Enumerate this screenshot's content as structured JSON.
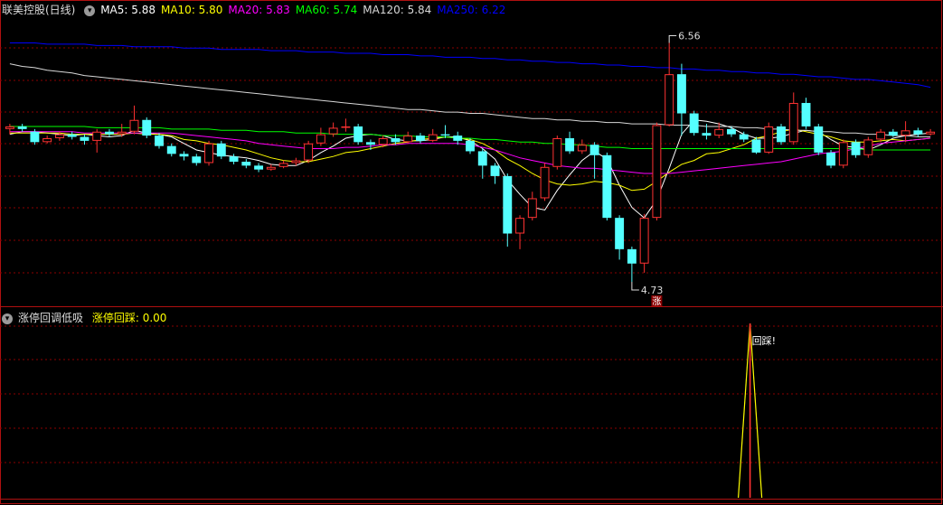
{
  "header": {
    "stock_name": "联美控股(日线)",
    "ma": [
      {
        "label": "MA5: 5.88",
        "color": "#ffffff"
      },
      {
        "label": "MA10: 5.80",
        "color": "#ffff00"
      },
      {
        "label": "MA20: 5.83",
        "color": "#ff00ff"
      },
      {
        "label": "MA60: 5.74",
        "color": "#00ff00"
      },
      {
        "label": "MA120: 5.84",
        "color": "#d8d8d8"
      },
      {
        "label": "MA250: 6.22",
        "color": "#0000ff"
      }
    ]
  },
  "indicator": {
    "name": "涨停回调低吸",
    "value_label": "涨停回踩: 0.00",
    "value_color": "#ffff00",
    "signal_label": "回踩!"
  },
  "colors": {
    "up": "#ff3232",
    "down": "#54ffff",
    "grid": "#8b0000",
    "border": "#b01010"
  },
  "chart_data": [
    {
      "type": "candlestick",
      "y_range": [
        4.55,
        6.75
      ],
      "high_annotation": "6.56",
      "low_annotation": "4.73",
      "limit_up_marker": "涨",
      "candles": [
        [
          5.9,
          5.92,
          5.94,
          5.86
        ],
        [
          5.92,
          5.9,
          5.94,
          5.88
        ],
        [
          5.88,
          5.8,
          5.9,
          5.78
        ],
        [
          5.8,
          5.83,
          5.85,
          5.79
        ],
        [
          5.83,
          5.86,
          5.88,
          5.81
        ],
        [
          5.86,
          5.84,
          5.88,
          5.82
        ],
        [
          5.84,
          5.81,
          5.86,
          5.78
        ],
        [
          5.81,
          5.88,
          5.9,
          5.72
        ],
        [
          5.88,
          5.86,
          5.9,
          5.84
        ],
        [
          5.86,
          5.88,
          5.94,
          5.84
        ],
        [
          5.88,
          5.97,
          6.08,
          5.86
        ],
        [
          5.97,
          5.85,
          5.99,
          5.83
        ],
        [
          5.85,
          5.77,
          5.87,
          5.75
        ],
        [
          5.77,
          5.71,
          5.79,
          5.69
        ],
        [
          5.71,
          5.69,
          5.73,
          5.66
        ],
        [
          5.69,
          5.64,
          5.71,
          5.62
        ],
        [
          5.64,
          5.79,
          5.81,
          5.62
        ],
        [
          5.79,
          5.69,
          5.81,
          5.67
        ],
        [
          5.69,
          5.65,
          5.71,
          5.63
        ],
        [
          5.65,
          5.62,
          5.67,
          5.6
        ],
        [
          5.62,
          5.59,
          5.64,
          5.57
        ],
        [
          5.59,
          5.61,
          5.63,
          5.58
        ],
        [
          5.61,
          5.64,
          5.66,
          5.6
        ],
        [
          5.64,
          5.66,
          5.68,
          5.62
        ],
        [
          5.66,
          5.79,
          5.81,
          5.64
        ],
        [
          5.79,
          5.86,
          5.91,
          5.77
        ],
        [
          5.86,
          5.91,
          5.95,
          5.84
        ],
        [
          5.91,
          5.92,
          5.98,
          5.88
        ],
        [
          5.92,
          5.8,
          5.94,
          5.78
        ],
        [
          5.8,
          5.78,
          5.82,
          5.74
        ],
        [
          5.78,
          5.83,
          5.85,
          5.76
        ],
        [
          5.83,
          5.8,
          5.86,
          5.78
        ],
        [
          5.8,
          5.85,
          5.88,
          5.79
        ],
        [
          5.85,
          5.81,
          5.87,
          5.79
        ],
        [
          5.81,
          5.86,
          5.9,
          5.8
        ],
        [
          5.86,
          5.85,
          5.93,
          5.83
        ],
        [
          5.85,
          5.81,
          5.88,
          5.78
        ],
        [
          5.81,
          5.73,
          5.83,
          5.71
        ],
        [
          5.73,
          5.62,
          5.75,
          5.52
        ],
        [
          5.62,
          5.54,
          5.64,
          5.48
        ],
        [
          5.54,
          5.1,
          5.56,
          5.0
        ],
        [
          5.1,
          5.22,
          5.24,
          4.98
        ],
        [
          5.22,
          5.37,
          5.42,
          5.2
        ],
        [
          5.37,
          5.61,
          5.64,
          5.35
        ],
        [
          5.61,
          5.83,
          5.85,
          5.59
        ],
        [
          5.83,
          5.73,
          5.88,
          5.71
        ],
        [
          5.73,
          5.78,
          5.82,
          5.71
        ],
        [
          5.78,
          5.7,
          5.8,
          5.52
        ],
        [
          5.7,
          5.22,
          5.72,
          5.2
        ],
        [
          5.22,
          4.98,
          5.24,
          4.9
        ],
        [
          4.98,
          4.87,
          5.0,
          4.73
        ],
        [
          4.87,
          5.22,
          5.25,
          4.8
        ],
        [
          5.22,
          5.93,
          5.95,
          5.2
        ],
        [
          5.93,
          6.32,
          6.56,
          5.92
        ],
        [
          6.32,
          6.02,
          6.4,
          5.85
        ],
        [
          6.02,
          5.87,
          6.04,
          5.85
        ],
        [
          5.87,
          5.85,
          5.94,
          5.82
        ],
        [
          5.85,
          5.9,
          5.95,
          5.83
        ],
        [
          5.9,
          5.86,
          5.92,
          5.84
        ],
        [
          5.86,
          5.82,
          5.88,
          5.8
        ],
        [
          5.82,
          5.72,
          5.84,
          5.71
        ],
        [
          5.72,
          5.92,
          5.95,
          5.71
        ],
        [
          5.92,
          5.8,
          5.94,
          5.78
        ],
        [
          5.8,
          6.1,
          6.18,
          5.78
        ],
        [
          6.1,
          5.92,
          6.14,
          5.9
        ],
        [
          5.92,
          5.72,
          5.94,
          5.7
        ],
        [
          5.72,
          5.62,
          5.74,
          5.6
        ],
        [
          5.62,
          5.8,
          5.82,
          5.6
        ],
        [
          5.8,
          5.7,
          5.82,
          5.68
        ],
        [
          5.7,
          5.82,
          5.84,
          5.68
        ],
        [
          5.82,
          5.88,
          5.9,
          5.8
        ],
        [
          5.88,
          5.85,
          5.9,
          5.84
        ],
        [
          5.85,
          5.89,
          5.96,
          5.8
        ],
        [
          5.89,
          5.86,
          5.91,
          5.84
        ],
        [
          5.86,
          5.88,
          5.9,
          5.85
        ]
      ],
      "series": [
        {
          "name": "MA5",
          "color": "#ffffff",
          "values": [
            5.86,
            5.88,
            5.88,
            5.87,
            5.86,
            5.85,
            5.86,
            5.85,
            5.84,
            5.85,
            5.89,
            5.87,
            5.86,
            5.84,
            5.79,
            5.74,
            5.72,
            5.7,
            5.69,
            5.68,
            5.66,
            5.63,
            5.62,
            5.62,
            5.66,
            5.72,
            5.77,
            5.83,
            5.85,
            5.86,
            5.85,
            5.82,
            5.81,
            5.81,
            5.82,
            5.84,
            5.84,
            5.81,
            5.75,
            5.67,
            5.51,
            5.4,
            5.3,
            5.28,
            5.43,
            5.55,
            5.66,
            5.73,
            5.67,
            5.47,
            5.3,
            5.22,
            5.36,
            5.6,
            5.86,
            5.97,
            5.96,
            5.94,
            5.91,
            5.86,
            5.83,
            5.83,
            5.84,
            5.87,
            5.89,
            5.88,
            5.82,
            5.77,
            5.76,
            5.74,
            5.78,
            5.83,
            5.85,
            5.86,
            5.87
          ]
        },
        {
          "name": "MA10",
          "color": "#ffff00",
          "values": [
            5.87,
            5.87,
            5.87,
            5.87,
            5.87,
            5.86,
            5.86,
            5.86,
            5.86,
            5.86,
            5.87,
            5.86,
            5.86,
            5.85,
            5.82,
            5.81,
            5.79,
            5.78,
            5.76,
            5.74,
            5.71,
            5.68,
            5.66,
            5.65,
            5.65,
            5.67,
            5.69,
            5.72,
            5.73,
            5.75,
            5.77,
            5.79,
            5.8,
            5.82,
            5.83,
            5.84,
            5.83,
            5.82,
            5.79,
            5.74,
            5.67,
            5.62,
            5.56,
            5.51,
            5.48,
            5.47,
            5.48,
            5.5,
            5.49,
            5.47,
            5.43,
            5.44,
            5.5,
            5.57,
            5.63,
            5.66,
            5.71,
            5.72,
            5.75,
            5.78,
            5.83,
            5.85,
            5.88,
            5.9,
            5.88,
            5.86,
            5.84,
            5.81,
            5.8,
            5.8,
            5.81,
            5.82,
            5.81,
            5.82,
            5.83
          ]
        },
        {
          "name": "MA20",
          "color": "#ff00ff",
          "values": [
            5.88,
            5.88,
            5.88,
            5.88,
            5.88,
            5.88,
            5.87,
            5.87,
            5.87,
            5.87,
            5.87,
            5.87,
            5.87,
            5.87,
            5.86,
            5.85,
            5.84,
            5.83,
            5.82,
            5.81,
            5.79,
            5.78,
            5.77,
            5.76,
            5.75,
            5.75,
            5.75,
            5.76,
            5.76,
            5.77,
            5.78,
            5.78,
            5.79,
            5.79,
            5.79,
            5.79,
            5.79,
            5.78,
            5.76,
            5.74,
            5.71,
            5.68,
            5.66,
            5.64,
            5.62,
            5.61,
            5.6,
            5.6,
            5.59,
            5.58,
            5.57,
            5.56,
            5.56,
            5.56,
            5.57,
            5.58,
            5.59,
            5.6,
            5.61,
            5.62,
            5.63,
            5.64,
            5.65,
            5.67,
            5.69,
            5.71,
            5.72,
            5.73,
            5.75,
            5.77,
            5.79,
            5.8,
            5.81,
            5.82,
            5.83
          ]
        },
        {
          "name": "MA60",
          "color": "#00ff00",
          "values": [
            5.92,
            5.92,
            5.92,
            5.92,
            5.92,
            5.92,
            5.92,
            5.91,
            5.91,
            5.91,
            5.91,
            5.91,
            5.91,
            5.9,
            5.9,
            5.9,
            5.9,
            5.89,
            5.89,
            5.89,
            5.88,
            5.88,
            5.88,
            5.87,
            5.87,
            5.87,
            5.86,
            5.86,
            5.86,
            5.86,
            5.85,
            5.85,
            5.85,
            5.84,
            5.84,
            5.84,
            5.83,
            5.83,
            5.82,
            5.82,
            5.81,
            5.8,
            5.8,
            5.79,
            5.79,
            5.78,
            5.78,
            5.77,
            5.76,
            5.76,
            5.75,
            5.75,
            5.75,
            5.75,
            5.75,
            5.75,
            5.75,
            5.75,
            5.75,
            5.75,
            5.75,
            5.75,
            5.75,
            5.75,
            5.75,
            5.75,
            5.75,
            5.75,
            5.75,
            5.74,
            5.74,
            5.74,
            5.74,
            5.74,
            5.74
          ]
        },
        {
          "name": "MA120",
          "color": "#d8d8d8",
          "values": [
            6.4,
            6.38,
            6.37,
            6.35,
            6.34,
            6.33,
            6.31,
            6.3,
            6.29,
            6.28,
            6.27,
            6.26,
            6.25,
            6.24,
            6.23,
            6.22,
            6.21,
            6.2,
            6.19,
            6.18,
            6.17,
            6.16,
            6.15,
            6.14,
            6.13,
            6.12,
            6.11,
            6.1,
            6.09,
            6.08,
            6.07,
            6.06,
            6.05,
            6.05,
            6.04,
            6.03,
            6.03,
            6.02,
            6.02,
            6.01,
            6.0,
            5.99,
            5.98,
            5.98,
            5.97,
            5.97,
            5.96,
            5.96,
            5.95,
            5.95,
            5.94,
            5.94,
            5.94,
            5.93,
            5.93,
            5.93,
            5.92,
            5.92,
            5.92,
            5.91,
            5.91,
            5.9,
            5.9,
            5.89,
            5.89,
            5.88,
            5.88,
            5.87,
            5.87,
            5.86,
            5.86,
            5.85,
            5.85,
            5.84,
            5.84
          ]
        },
        {
          "name": "MA250",
          "color": "#0000ff",
          "values": [
            6.56,
            6.56,
            6.56,
            6.55,
            6.55,
            6.55,
            6.55,
            6.54,
            6.54,
            6.54,
            6.53,
            6.53,
            6.53,
            6.53,
            6.52,
            6.52,
            6.52,
            6.51,
            6.51,
            6.51,
            6.51,
            6.5,
            6.5,
            6.5,
            6.49,
            6.49,
            6.49,
            6.48,
            6.48,
            6.48,
            6.47,
            6.47,
            6.47,
            6.46,
            6.46,
            6.45,
            6.45,
            6.45,
            6.44,
            6.44,
            6.43,
            6.43,
            6.42,
            6.42,
            6.41,
            6.41,
            6.4,
            6.4,
            6.39,
            6.39,
            6.38,
            6.38,
            6.37,
            6.37,
            6.36,
            6.36,
            6.35,
            6.35,
            6.34,
            6.34,
            6.33,
            6.33,
            6.32,
            6.32,
            6.31,
            6.3,
            6.3,
            6.29,
            6.28,
            6.28,
            6.27,
            6.26,
            6.25,
            6.24,
            6.22
          ]
        }
      ]
    },
    {
      "type": "line",
      "series": [
        {
          "name": "涨停回踩",
          "color": "#ffff00",
          "values": [
            0,
            0,
            0,
            0,
            0,
            0,
            0,
            0,
            0,
            0,
            0,
            0,
            0,
            0,
            0,
            0,
            0,
            0,
            0,
            0,
            0,
            0,
            0,
            0,
            0,
            0,
            0,
            0,
            0,
            0,
            0,
            0,
            0,
            0,
            0,
            0,
            0,
            0,
            0,
            0,
            0,
            0,
            0,
            0,
            0,
            0,
            0,
            0,
            0,
            0,
            0,
            0,
            0,
            0,
            0,
            0,
            0,
            0,
            0,
            0,
            0,
            0,
            0,
            0,
            0,
            0,
            0,
            0,
            0,
            0,
            0,
            0,
            0,
            0,
            0
          ]
        }
      ],
      "signal_index": 60,
      "signal_value": 1,
      "y_range": [
        0,
        1
      ]
    }
  ]
}
